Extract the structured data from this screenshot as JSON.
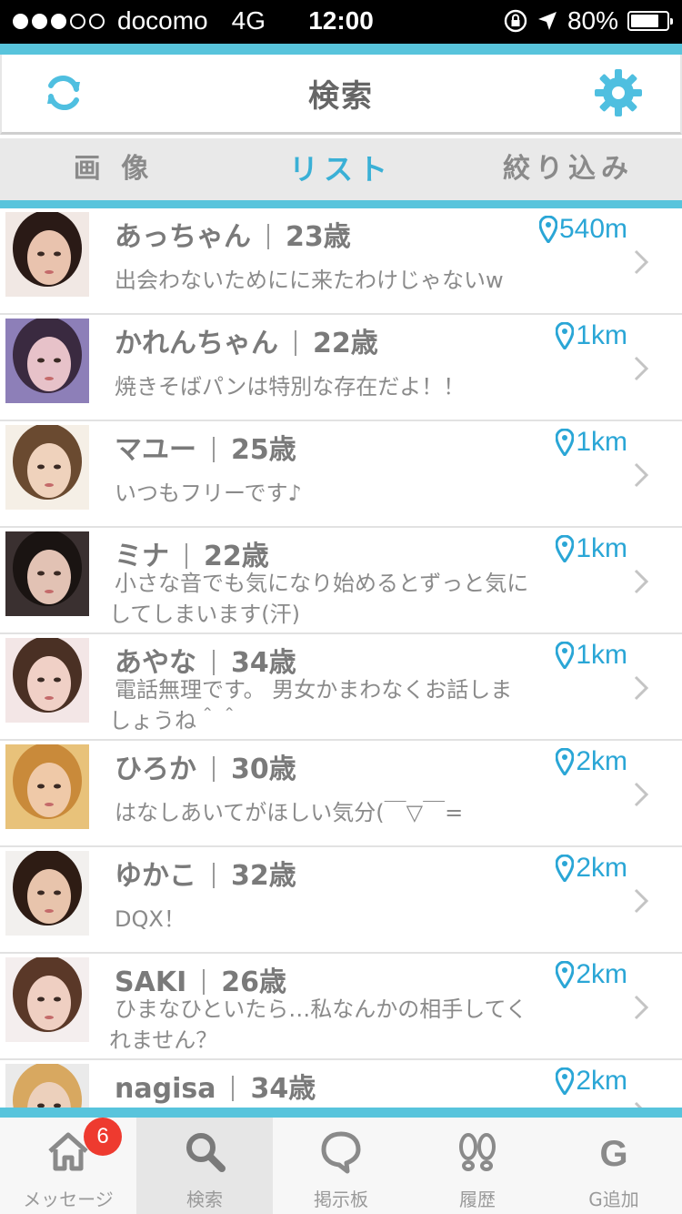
{
  "status_bar": {
    "carrier": "docomo",
    "network": "4G",
    "time": "12:00",
    "battery": "80%",
    "battery_level": 0.8,
    "signal_bars_filled": 3,
    "signal_bars_total": 5
  },
  "header": {
    "title": "検索",
    "refresh_icon": "refresh-icon",
    "settings_icon": "gear-icon"
  },
  "tabs": [
    {
      "label": "画 像",
      "active": false
    },
    {
      "label": "リスト",
      "active": true
    },
    {
      "label": "絞り込み",
      "active": false
    }
  ],
  "profiles": [
    {
      "name": "あっちゃん",
      "age": "23歳",
      "distance": "540m",
      "message": [
        "出会わないためにに来たわけじゃないw"
      ]
    },
    {
      "name": "かれんちゃん",
      "age": "22歳",
      "distance": "1km",
      "message": [
        "焼きそばパンは特別な存在だよ！！"
      ]
    },
    {
      "name": "マユー",
      "age": "25歳",
      "distance": "1km",
      "message": [
        "いつもフリーです♪"
      ]
    },
    {
      "name": "ミナ",
      "age": "22歳",
      "distance": "1km",
      "message": [
        "小さな音でも気になり始めるとずっと気に",
        "してしまいます(汗)"
      ]
    },
    {
      "name": "あやな",
      "age": "34歳",
      "distance": "1km",
      "message": [
        "電話無理です。 男女かまわなくお話しま",
        "しょうね＾＾"
      ]
    },
    {
      "name": "ひろか",
      "age": "30歳",
      "distance": "2km",
      "message": [
        "はなしあいてがほしい気分(￣▽￣="
      ]
    },
    {
      "name": "ゆかこ",
      "age": "32歳",
      "distance": "2km",
      "message": [
        "DQX！"
      ]
    },
    {
      "name": "SAKI",
      "age": "26歳",
      "distance": "2km",
      "message": [
        "ひまなひといたら…私なんかの相手してく",
        "れません？"
      ]
    },
    {
      "name": "nagisa",
      "age": "34歳",
      "distance": "2km",
      "message": []
    }
  ],
  "bottom_nav": [
    {
      "label": "メッセージ",
      "icon": "home-icon",
      "badge": "6",
      "active": false
    },
    {
      "label": "検索",
      "icon": "search-icon",
      "active": true
    },
    {
      "label": "掲示板",
      "icon": "speech-bubble-icon",
      "active": false
    },
    {
      "label": "履歴",
      "icon": "footprints-icon",
      "active": false
    },
    {
      "label": "G追加",
      "icon": "g-icon",
      "active": false
    }
  ],
  "colors": {
    "accent": "#58c4dc",
    "active_tab": "#3ab0d6",
    "distance": "#2aa6d6",
    "badge": "#ee3a2f"
  }
}
